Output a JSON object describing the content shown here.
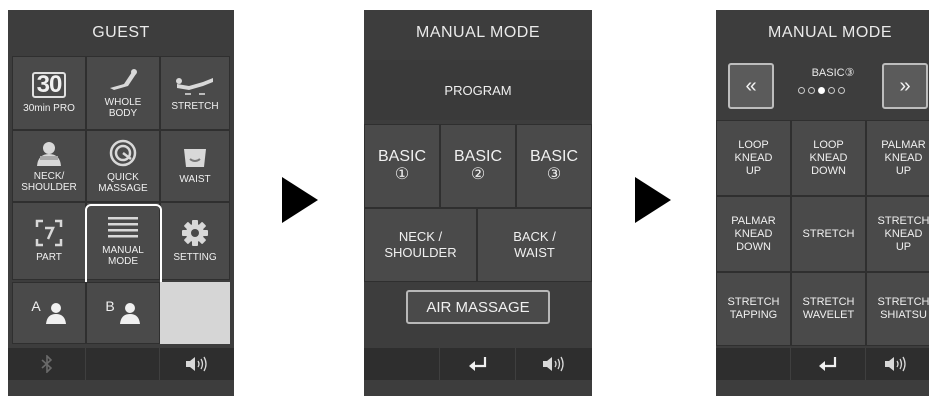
{
  "screen1": {
    "title": "GUEST",
    "tiles": [
      {
        "icon": "30min-pro-icon",
        "icon_text": "30",
        "label": "30min PRO"
      },
      {
        "icon": "whole-body-recline-icon",
        "label": "WHOLE BODY"
      },
      {
        "icon": "stretch-recline-icon",
        "label": "STRETCH"
      },
      {
        "icon": "neck-shoulder-icon",
        "label": "NECK/ SHOULDER"
      },
      {
        "icon": "quick-massage-icon",
        "label": "QUICK MASSAGE"
      },
      {
        "icon": "waist-icon",
        "label": "WAIST"
      },
      {
        "icon": "part-focus-icon",
        "label": "PART"
      },
      {
        "icon": "manual-mode-menu-icon",
        "label": "MANUAL MODE"
      },
      {
        "icon": "gear-icon",
        "label": "SETTING"
      }
    ],
    "users": [
      {
        "letter": "A",
        "icon": "user-icon"
      },
      {
        "letter": "B",
        "icon": "user-icon"
      }
    ],
    "bottom": {
      "left": "bluetooth-icon",
      "right": "speaker-icon"
    }
  },
  "screen2": {
    "title": "MANUAL MODE",
    "program_label": "PROGRAM",
    "basic": [
      {
        "label": "BASIC",
        "num": "①"
      },
      {
        "label": "BASIC",
        "num": "②"
      },
      {
        "label": "BASIC",
        "num": "③"
      }
    ],
    "areas": [
      {
        "line1": "NECK /",
        "line2": "SHOULDER"
      },
      {
        "line1": "BACK /",
        "line2": "WAIST"
      }
    ],
    "air_label": "AIR MASSAGE",
    "bottom": {
      "middle": "return-icon",
      "right": "speaker-icon"
    }
  },
  "screen3": {
    "title": "MANUAL MODE",
    "nav": {
      "prev": "«",
      "next": "»",
      "label": "BASIC③",
      "page_count": 5,
      "active_page": 3
    },
    "grid": [
      [
        "LOOP",
        "KNEAD",
        "UP"
      ],
      [
        "LOOP",
        "KNEAD",
        "DOWN"
      ],
      [
        "PALMAR",
        "KNEAD",
        "UP"
      ],
      [
        "PALMAR",
        "KNEAD",
        "DOWN"
      ],
      [
        "STRETCH"
      ],
      [
        "STRETCH",
        "KNEAD",
        "UP"
      ],
      [
        "STRETCH",
        "TAPPING"
      ],
      [
        "STRETCH",
        "WAVELET"
      ],
      [
        "STRETCH",
        "SHIATSU"
      ]
    ],
    "bottom": {
      "middle": "return-icon",
      "right": "speaker-icon"
    }
  },
  "colors": {
    "panel": "#3d3d3d",
    "tile": "#4a4a4a",
    "text": "#f0f0f0",
    "highlight": "#ffffff"
  }
}
